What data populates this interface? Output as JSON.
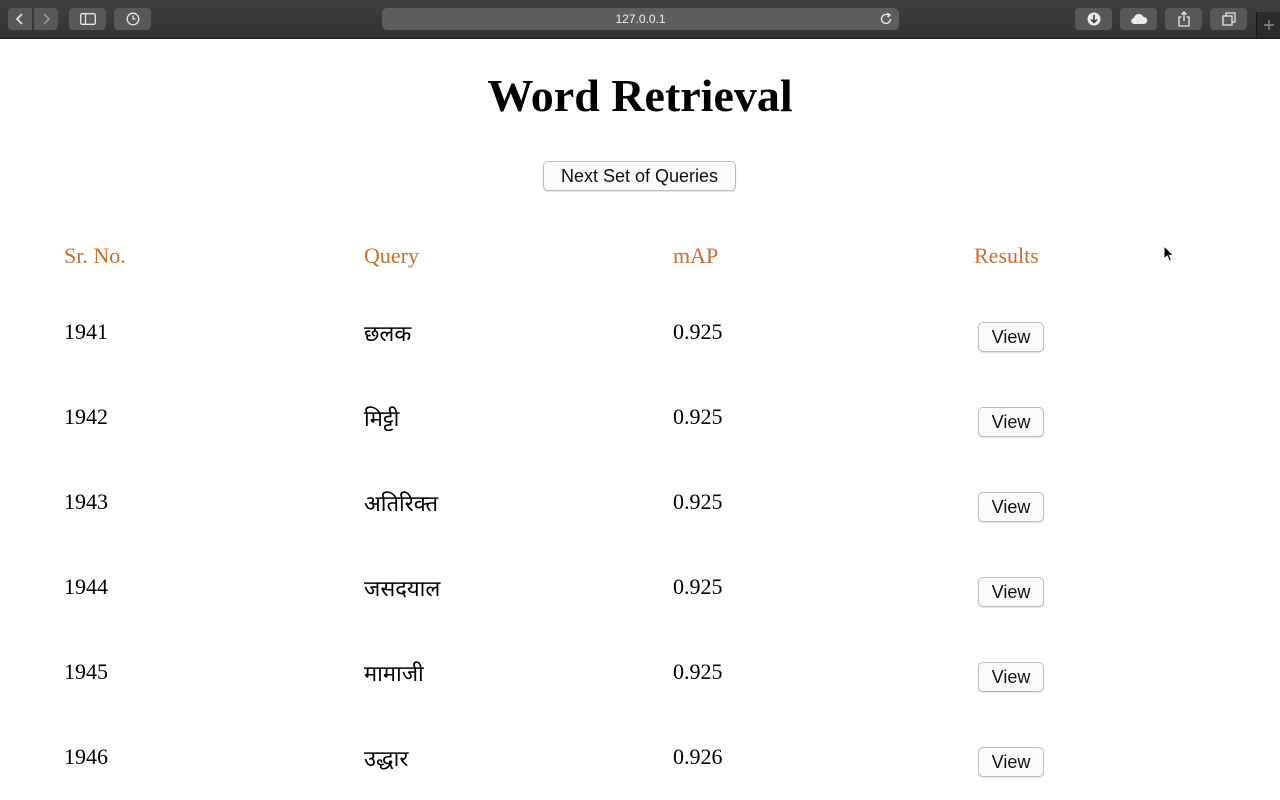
{
  "browser": {
    "url": "127.0.0.1",
    "icons": [
      "back-icon",
      "forward-icon",
      "sidebar-icon",
      "history-icon",
      "reload-icon",
      "download-icon",
      "cloud-icon",
      "share-icon",
      "tabs-icon",
      "new-tab-icon"
    ]
  },
  "page": {
    "title": "Word Retrieval",
    "next_button": "Next Set of Queries"
  },
  "table": {
    "headers": [
      "Sr. No.",
      "Query",
      "mAP",
      "Results"
    ],
    "rows": [
      {
        "sr_no": "1941",
        "query": "छलक",
        "map": "0.925",
        "result_button": "View"
      },
      {
        "sr_no": "1942",
        "query": "मिट्टी",
        "map": "0.925",
        "result_button": "View"
      },
      {
        "sr_no": "1943",
        "query": "अतिरिक्त",
        "map": "0.925",
        "result_button": "View"
      },
      {
        "sr_no": "1944",
        "query": "जसदयाल",
        "map": "0.925",
        "result_button": "View"
      },
      {
        "sr_no": "1945",
        "query": "मामाजी",
        "map": "0.925",
        "result_button": "View"
      },
      {
        "sr_no": "1946",
        "query": "उद्धार",
        "map": "0.926",
        "result_button": "View"
      }
    ]
  },
  "colors": {
    "header_text": "#cc6c2e",
    "toolbar_bg": "#3a3a3c"
  }
}
